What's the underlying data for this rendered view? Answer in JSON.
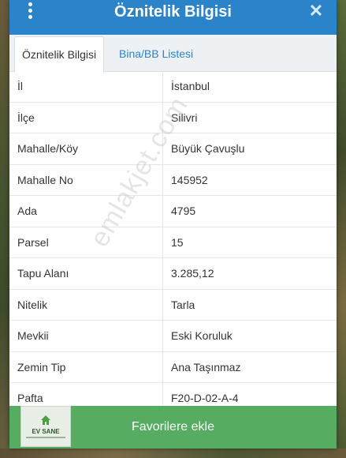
{
  "header": {
    "title": "Öznitelik Bilgisi",
    "menu_icon": "kebab-menu-icon",
    "close_icon": "close-icon",
    "color": "#2b84c9"
  },
  "tabs": [
    {
      "label": "Öznitelik Bilgisi",
      "active": true
    },
    {
      "label": "Bina/BB Listesi",
      "active": false
    }
  ],
  "rows": [
    {
      "label": "İl",
      "value": "İstanbul"
    },
    {
      "label": "İlçe",
      "value": "Silivri"
    },
    {
      "label": "Mahalle/Köy",
      "value": "Büyük Çavuşlu"
    },
    {
      "label": "Mahalle No",
      "value": "145952"
    },
    {
      "label": "Ada",
      "value": "4795"
    },
    {
      "label": "Parsel",
      "value": "15"
    },
    {
      "label": "Tapu Alanı",
      "value": "3.285,12"
    },
    {
      "label": "Nitelik",
      "value": "Tarla"
    },
    {
      "label": "Mevkii",
      "value": "Eski Koruluk"
    },
    {
      "label": "Zemin Tip",
      "value": "Ana Taşınmaz"
    },
    {
      "label": "Pafta",
      "value": "F20-D-02-A-4"
    }
  ],
  "watermark": "emlakjet.com",
  "footer": {
    "button_label": "Favorilere ekle",
    "color": "#56ac60",
    "logo_text": "EV SANE"
  }
}
